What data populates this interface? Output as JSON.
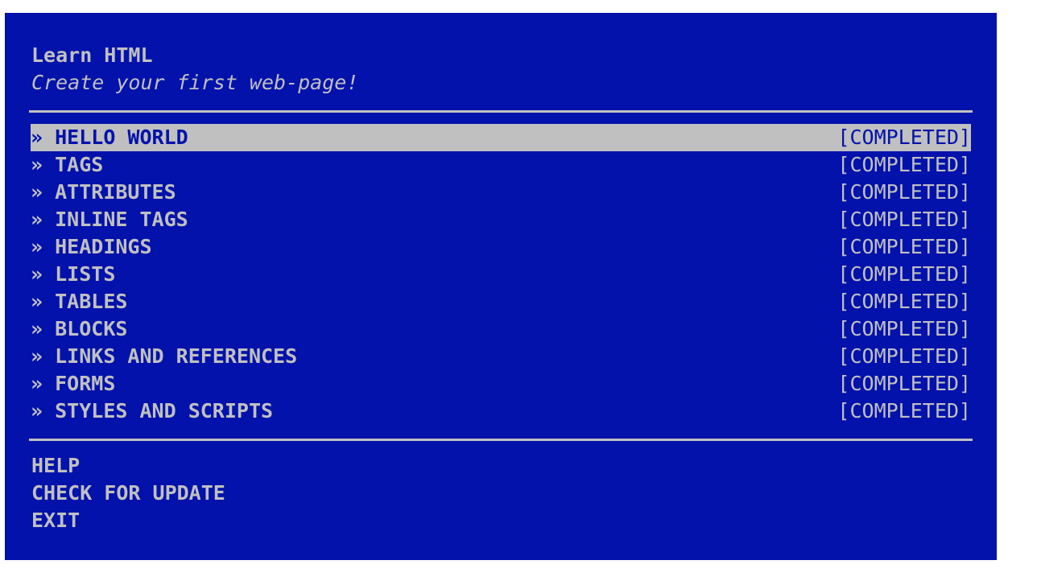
{
  "app": {
    "title": "Learn HTML",
    "subtitle": "Create your first web-page!"
  },
  "colors": {
    "background": "#0212aa",
    "foreground": "#c0c0c0",
    "highlight_bg": "#c0c0c0",
    "highlight_fg": "#0212aa"
  },
  "lesson_marker": "»",
  "lessons": [
    {
      "label": "HELLO WORLD",
      "status": "[COMPLETED]",
      "selected": true
    },
    {
      "label": "TAGS",
      "status": "[COMPLETED]",
      "selected": false
    },
    {
      "label": "ATTRIBUTES",
      "status": "[COMPLETED]",
      "selected": false
    },
    {
      "label": "INLINE TAGS",
      "status": "[COMPLETED]",
      "selected": false
    },
    {
      "label": "HEADINGS",
      "status": "[COMPLETED]",
      "selected": false
    },
    {
      "label": "LISTS",
      "status": "[COMPLETED]",
      "selected": false
    },
    {
      "label": "TABLES",
      "status": "[COMPLETED]",
      "selected": false
    },
    {
      "label": "BLOCKS",
      "status": "[COMPLETED]",
      "selected": false
    },
    {
      "label": "LINKS AND REFERENCES",
      "status": "[COMPLETED]",
      "selected": false
    },
    {
      "label": "FORMS",
      "status": "[COMPLETED]",
      "selected": false
    },
    {
      "label": "STYLES AND SCRIPTS",
      "status": "[COMPLETED]",
      "selected": false
    }
  ],
  "footer_menu": [
    {
      "label": "HELP"
    },
    {
      "label": "CHECK FOR UPDATE"
    },
    {
      "label": "EXIT"
    }
  ]
}
